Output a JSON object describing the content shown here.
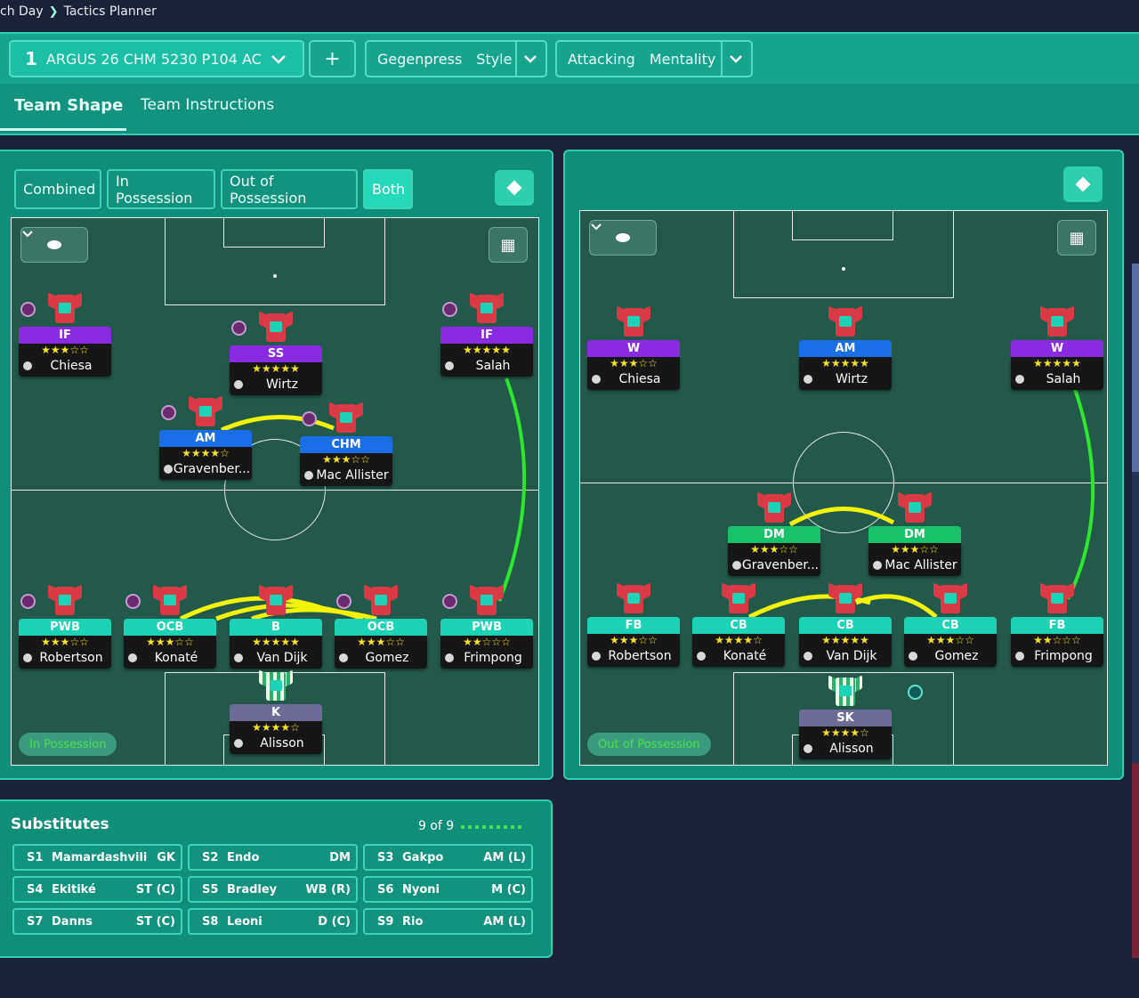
{
  "breadcrumb": {
    "parent": "ch Day",
    "current": "Tactics Planner"
  },
  "topbar": {
    "tactic_number": "1",
    "tactic_name": "ARGUS 26 CHM 5230 P104 AC",
    "add_label": "+",
    "style_value": "Gegenpress",
    "style_label": "Style",
    "mentality_value": "Attacking",
    "mentality_label": "Mentality"
  },
  "tabs": [
    {
      "label": "Team Shape"
    },
    {
      "label": "Team Instructions"
    }
  ],
  "view_toggle": [
    "Combined",
    "In Possession",
    "Out of Possession",
    "Both"
  ],
  "left_pitch": {
    "phase_label": "In Possession",
    "players": [
      {
        "role": "IF",
        "stars": "★★★☆☆",
        "name": "Chiesa"
      },
      {
        "role": "SS",
        "stars": "★★★★★",
        "name": "Wirtz"
      },
      {
        "role": "IF",
        "stars": "★★★★★",
        "name": "Salah"
      },
      {
        "role": "AM",
        "stars": "★★★★☆",
        "name": "Gravenber..."
      },
      {
        "role": "CHM",
        "stars": "★★★☆☆",
        "name": "Mac Allister"
      },
      {
        "role": "PWB",
        "stars": "★★★☆☆",
        "name": "Robertson"
      },
      {
        "role": "OCB",
        "stars": "★★★☆☆",
        "name": "Konaté"
      },
      {
        "role": "B",
        "stars": "★★★★★",
        "name": "Van Dijk"
      },
      {
        "role": "OCB",
        "stars": "★★★☆☆",
        "name": "Gomez"
      },
      {
        "role": "PWB",
        "stars": "★★☆☆☆",
        "name": "Frimpong"
      },
      {
        "role": "K",
        "stars": "★★★★☆",
        "name": "Alisson"
      }
    ]
  },
  "right_pitch": {
    "phase_label": "Out of Possession",
    "players": [
      {
        "role": "W",
        "stars": "★★★☆☆",
        "name": "Chiesa"
      },
      {
        "role": "AM",
        "stars": "★★★★★",
        "name": "Wirtz"
      },
      {
        "role": "W",
        "stars": "★★★★★",
        "name": "Salah"
      },
      {
        "role": "DM",
        "stars": "★★★☆☆",
        "name": "Gravenber..."
      },
      {
        "role": "DM",
        "stars": "★★★☆☆",
        "name": "Mac Allister"
      },
      {
        "role": "FB",
        "stars": "★★★☆☆",
        "name": "Robertson"
      },
      {
        "role": "CB",
        "stars": "★★★★☆",
        "name": "Konaté"
      },
      {
        "role": "CB",
        "stars": "★★★★★",
        "name": "Van Dijk"
      },
      {
        "role": "CB",
        "stars": "★★★☆☆",
        "name": "Gomez"
      },
      {
        "role": "FB",
        "stars": "★★☆☆☆",
        "name": "Frimpong"
      },
      {
        "role": "SK",
        "stars": "★★★★☆",
        "name": "Alisson"
      }
    ]
  },
  "substitutes": {
    "title": "Substitutes",
    "count": "9 of 9",
    "list": [
      {
        "slot": "S1",
        "name": "Mamardashvili",
        "pos": "GK"
      },
      {
        "slot": "S2",
        "name": "Endo",
        "pos": "DM"
      },
      {
        "slot": "S3",
        "name": "Gakpo",
        "pos": "AM (L)"
      },
      {
        "slot": "S4",
        "name": "Ekitiké",
        "pos": "ST (C)"
      },
      {
        "slot": "S5",
        "name": "Bradley",
        "pos": "WB (R)"
      },
      {
        "slot": "S6",
        "name": "Nyoni",
        "pos": "M (C)"
      },
      {
        "slot": "S7",
        "name": "Danns",
        "pos": "ST (C)"
      },
      {
        "slot": "S8",
        "name": "Leoni",
        "pos": "D (C)"
      },
      {
        "slot": "S9",
        "name": "Rio",
        "pos": "AM (L)"
      }
    ]
  },
  "colors": {
    "accent": "#16a58c",
    "pitch": "#22594a",
    "link_line": "#f3f30a",
    "run_line": "#2ee62e",
    "background": "#1b2237"
  }
}
